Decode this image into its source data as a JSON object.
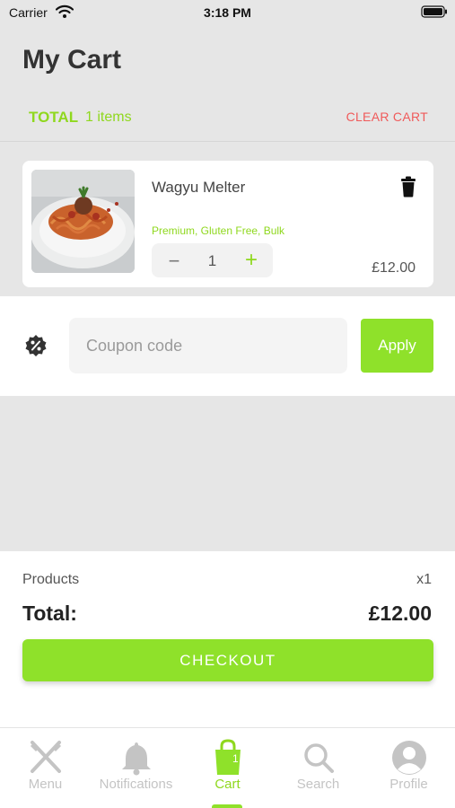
{
  "status_bar": {
    "carrier": "Carrier",
    "time": "3:18 PM"
  },
  "header": {
    "title": "My Cart"
  },
  "summary": {
    "total_label": "TOTAL",
    "items_count": "1 items",
    "clear_cart": "CLEAR CART"
  },
  "cart_items": [
    {
      "name": "Wagyu Melter",
      "options": "Premium, Gluten Free, Bulk",
      "quantity": "1",
      "price": "£12.00",
      "minus": "−",
      "plus": "+"
    }
  ],
  "coupon": {
    "placeholder": "Coupon code",
    "apply_label": "Apply"
  },
  "order_summary": {
    "products_label": "Products",
    "products_count": "x1",
    "total_label": "Total:",
    "total_value": "£12.00",
    "checkout_label": "CHECKOUT"
  },
  "tabs": [
    {
      "label": "Menu",
      "icon": "utensils-icon",
      "active": false
    },
    {
      "label": "Notifications",
      "icon": "bell-icon",
      "active": false
    },
    {
      "label": "Cart",
      "icon": "shopping-bag-icon",
      "active": true,
      "badge": "1"
    },
    {
      "label": "Search",
      "icon": "search-icon",
      "active": false
    },
    {
      "label": "Profile",
      "icon": "user-icon",
      "active": false
    }
  ],
  "colors": {
    "accent": "#8fe12a",
    "danger": "#f05a5a",
    "background": "#e6e6e6"
  }
}
